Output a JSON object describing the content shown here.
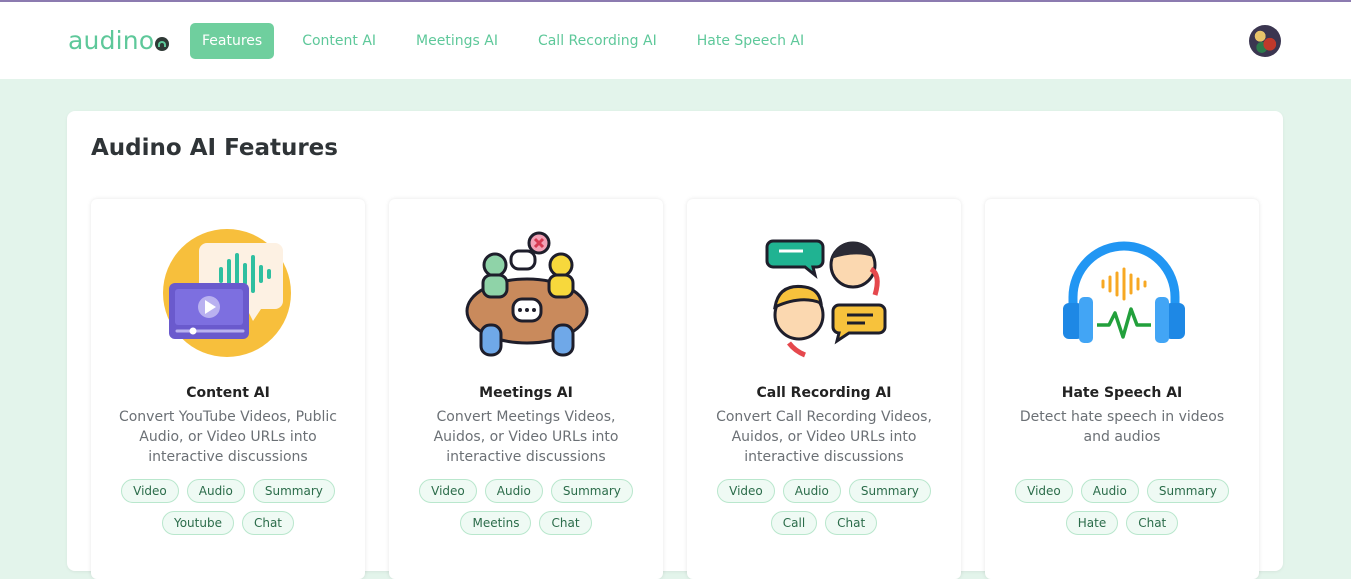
{
  "brand": {
    "name": "audino"
  },
  "nav": {
    "items": [
      {
        "label": "Features",
        "active": true
      },
      {
        "label": "Content AI",
        "active": false
      },
      {
        "label": "Meetings AI",
        "active": false
      },
      {
        "label": "Call Recording AI",
        "active": false
      },
      {
        "label": "Hate Speech AI",
        "active": false
      }
    ]
  },
  "page": {
    "title": "Audino AI Features"
  },
  "cards": [
    {
      "title": "Content AI",
      "description": "Convert YouTube Videos, Public Audio, or Video URLs into interactive discussions",
      "tags": [
        "Video",
        "Audio",
        "Summary",
        "Youtube",
        "Chat"
      ],
      "icon": "video-chat-illustration"
    },
    {
      "title": "Meetings AI",
      "description": "Convert Meetings Videos, Auidos, or Video URLs into interactive discussions",
      "tags": [
        "Video",
        "Audio",
        "Summary",
        "Meetins",
        "Chat"
      ],
      "icon": "meeting-table-illustration"
    },
    {
      "title": "Call Recording AI",
      "description": "Convert Call Recording Videos, Auidos, or Video URLs into interactive discussions",
      "tags": [
        "Video",
        "Audio",
        "Summary",
        "Call",
        "Chat"
      ],
      "icon": "phone-call-illustration"
    },
    {
      "title": "Hate Speech AI",
      "description": "Detect hate speech in videos and audios",
      "tags": [
        "Video",
        "Audio",
        "Summary",
        "Hate",
        "Chat"
      ],
      "icon": "headphones-illustration"
    }
  ],
  "colors": {
    "accent": "#6fcf9e",
    "brand_text": "#5ec89a",
    "page_bg": "#e3f4eb"
  }
}
